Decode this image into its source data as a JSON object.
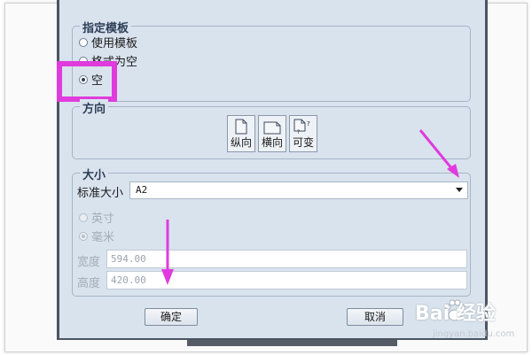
{
  "template_group": {
    "title": "指定模板",
    "options": [
      {
        "label": "使用模板",
        "checked": false
      },
      {
        "label": "格式为空",
        "checked": false
      },
      {
        "label": "空",
        "checked": true
      }
    ]
  },
  "orientation_group": {
    "title": "方向",
    "buttons": [
      {
        "label": "纵向",
        "icon": "portrait-page-icon"
      },
      {
        "label": "横向",
        "icon": "landscape-page-icon"
      },
      {
        "label": "可变",
        "icon": "variable-page-icon"
      }
    ]
  },
  "size_group": {
    "title": "大小",
    "standard_label": "标准大小",
    "standard_value": "A2",
    "units": [
      {
        "label": "英寸",
        "checked": false,
        "disabled": true
      },
      {
        "label": "毫米",
        "checked": true,
        "disabled": true
      }
    ],
    "width_label": "宽度",
    "width_value": "594.00",
    "height_label": "高度",
    "height_value": "420.00"
  },
  "buttons": {
    "ok": "确定",
    "cancel": "取消"
  },
  "watermark": {
    "brand": "Bai 经验",
    "url": "jingyan.baidu.com"
  },
  "colors": {
    "dialog_bg": "#d9e3ee",
    "highlight": "#e03bdd",
    "arrow": "#e03bdd"
  }
}
